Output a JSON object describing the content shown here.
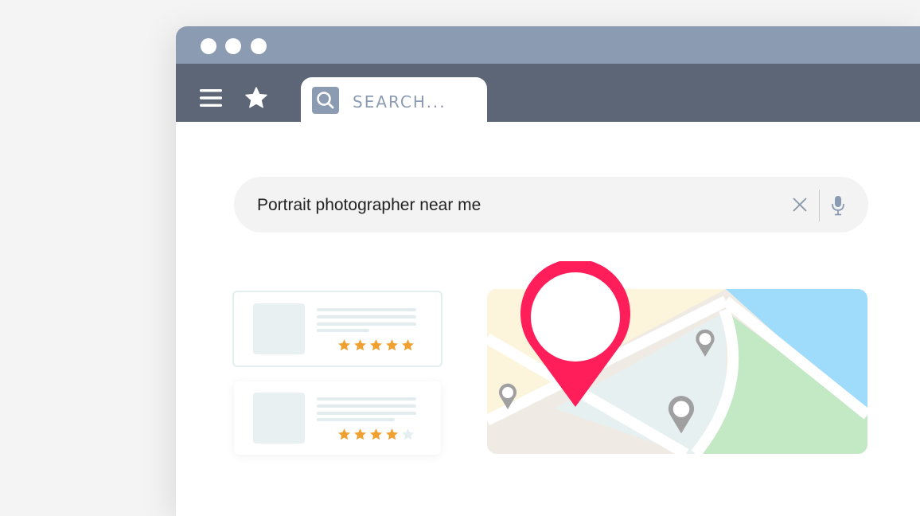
{
  "window": {
    "titlebar_color": "#8a9bb2",
    "toolbar_color": "#5d6677",
    "window_controls": [
      "dot",
      "dot",
      "dot"
    ]
  },
  "toolbar": {
    "menu_icon": "hamburger-icon",
    "bookmark_icon": "star-icon",
    "tab": {
      "search_icon": "magnifier-icon",
      "label": "SEARCH..."
    }
  },
  "search": {
    "query": "Portrait photographer near me",
    "clear_icon": "close-icon",
    "voice_icon": "microphone-icon"
  },
  "results": [
    {
      "rating": 5,
      "max_rating": 5
    },
    {
      "rating": 4,
      "max_rating": 5
    }
  ],
  "colors": {
    "pin_accent": "#ff1e5a",
    "star_filled": "#f0a030",
    "star_empty": "#e4eef0",
    "map_water": "#9fdcfb",
    "map_park": "#c2e8c4",
    "map_sand": "#fdf4dc",
    "map_block": "#e6f0f1",
    "map_ground": "#efebe4"
  },
  "map": {
    "main_pin_icon": "location-pin-icon",
    "small_pins": 3
  }
}
